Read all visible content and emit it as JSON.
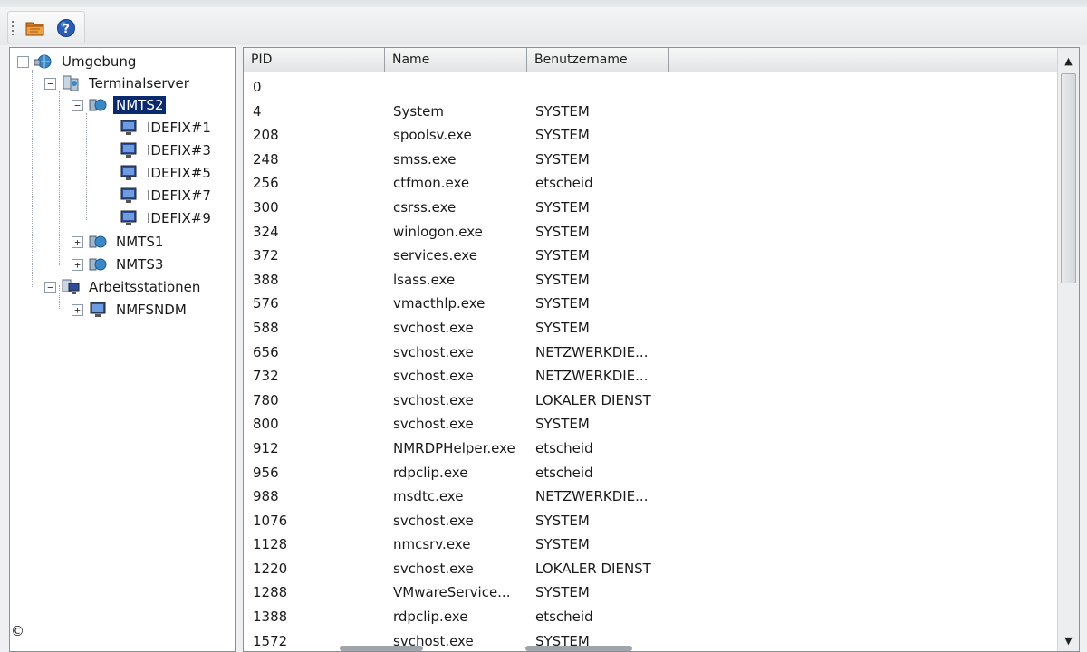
{
  "menubar": {
    "items": [
      "",
      "",
      "",
      ""
    ]
  },
  "toolbar": {
    "buttons": [
      {
        "icon": "folder-icon"
      },
      {
        "icon": "help-icon"
      }
    ]
  },
  "tree": {
    "root": "Umgebung",
    "terminalserver": "Terminalserver",
    "nmts2": "NMTS2",
    "sessions": [
      "IDEFIX#1",
      "IDEFIX#3",
      "IDEFIX#5",
      "IDEFIX#7",
      "IDEFIX#9"
    ],
    "nmts1": "NMTS1",
    "nmts3": "NMTS3",
    "arbeitsstationen": "Arbeitsstationen",
    "nmfsndm": "NMFSNDM"
  },
  "table": {
    "columns": [
      "PID",
      "Name",
      "Benutzername"
    ],
    "rows": [
      [
        "0",
        "",
        ""
      ],
      [
        "4",
        "System",
        "SYSTEM"
      ],
      [
        "208",
        "spoolsv.exe",
        "SYSTEM"
      ],
      [
        "248",
        "smss.exe",
        "SYSTEM"
      ],
      [
        "256",
        "ctfmon.exe",
        "etscheid"
      ],
      [
        "300",
        "csrss.exe",
        "SYSTEM"
      ],
      [
        "324",
        "winlogon.exe",
        "SYSTEM"
      ],
      [
        "372",
        "services.exe",
        "SYSTEM"
      ],
      [
        "388",
        "lsass.exe",
        "SYSTEM"
      ],
      [
        "576",
        "vmacthlp.exe",
        "SYSTEM"
      ],
      [
        "588",
        "svchost.exe",
        "SYSTEM"
      ],
      [
        "656",
        "svchost.exe",
        "NETZWERKDIE..."
      ],
      [
        "732",
        "svchost.exe",
        "NETZWERKDIE..."
      ],
      [
        "780",
        "svchost.exe",
        "LOKALER DIENST"
      ],
      [
        "800",
        "svchost.exe",
        "SYSTEM"
      ],
      [
        "912",
        "NMRDPHelper.exe",
        "etscheid"
      ],
      [
        "956",
        "rdpclip.exe",
        "etscheid"
      ],
      [
        "988",
        "msdtc.exe",
        "NETZWERKDIE..."
      ],
      [
        "1076",
        "svchost.exe",
        "SYSTEM"
      ],
      [
        "1128",
        "nmcsrv.exe",
        "SYSTEM"
      ],
      [
        "1220",
        "svchost.exe",
        "LOKALER DIENST"
      ],
      [
        "1288",
        "VMwareService...",
        "SYSTEM"
      ],
      [
        "1388",
        "rdpclip.exe",
        "etscheid"
      ],
      [
        "1572",
        "svchost.exe",
        "SYSTEM"
      ]
    ]
  },
  "footer": {
    "copyright": "©"
  }
}
